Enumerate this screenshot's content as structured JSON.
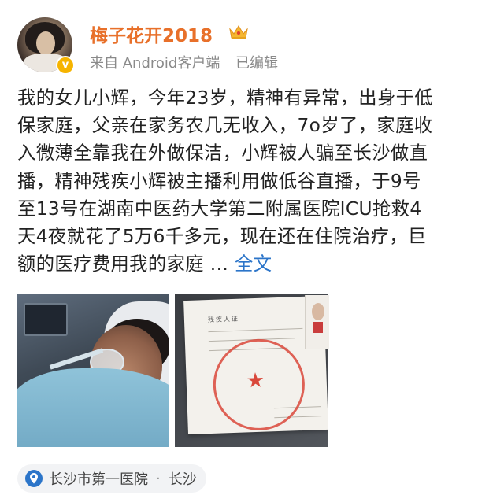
{
  "post": {
    "username": "梅子花开2018",
    "source_text": "来自 Android客户端",
    "edited_text": "已编辑",
    "body_lines": [
      "我的女儿小辉，今年23岁，精神有异常，出身于低",
      "保家庭，父亲在家务农几无收入，7o岁了，家庭收",
      "入微薄全靠我在外做保洁，小辉被人骗至长沙做直",
      "播，精神残疾小辉被主播利用做低谷直播，于9号",
      "至13号在湖南中医药大学第二附属医院ICU抢救4",
      "天4夜就花了5万6千多元，现在还在住院治疗，巨",
      "额的医疗费用我的家庭"
    ],
    "ellipsis": " ... ",
    "full_text_link": "全文",
    "location_name": "长沙市第一医院",
    "location_dot": "·",
    "location_city": "长沙"
  },
  "certificate": {
    "title": "残疾人证"
  },
  "colors": {
    "username": "#e8702a",
    "link": "#2c75c9",
    "verified_badge": "#f6b400",
    "seal": "#d9483b"
  },
  "icons": {
    "crown": "crown-icon",
    "verified": "verified-badge-icon",
    "location": "location-pin-icon"
  }
}
